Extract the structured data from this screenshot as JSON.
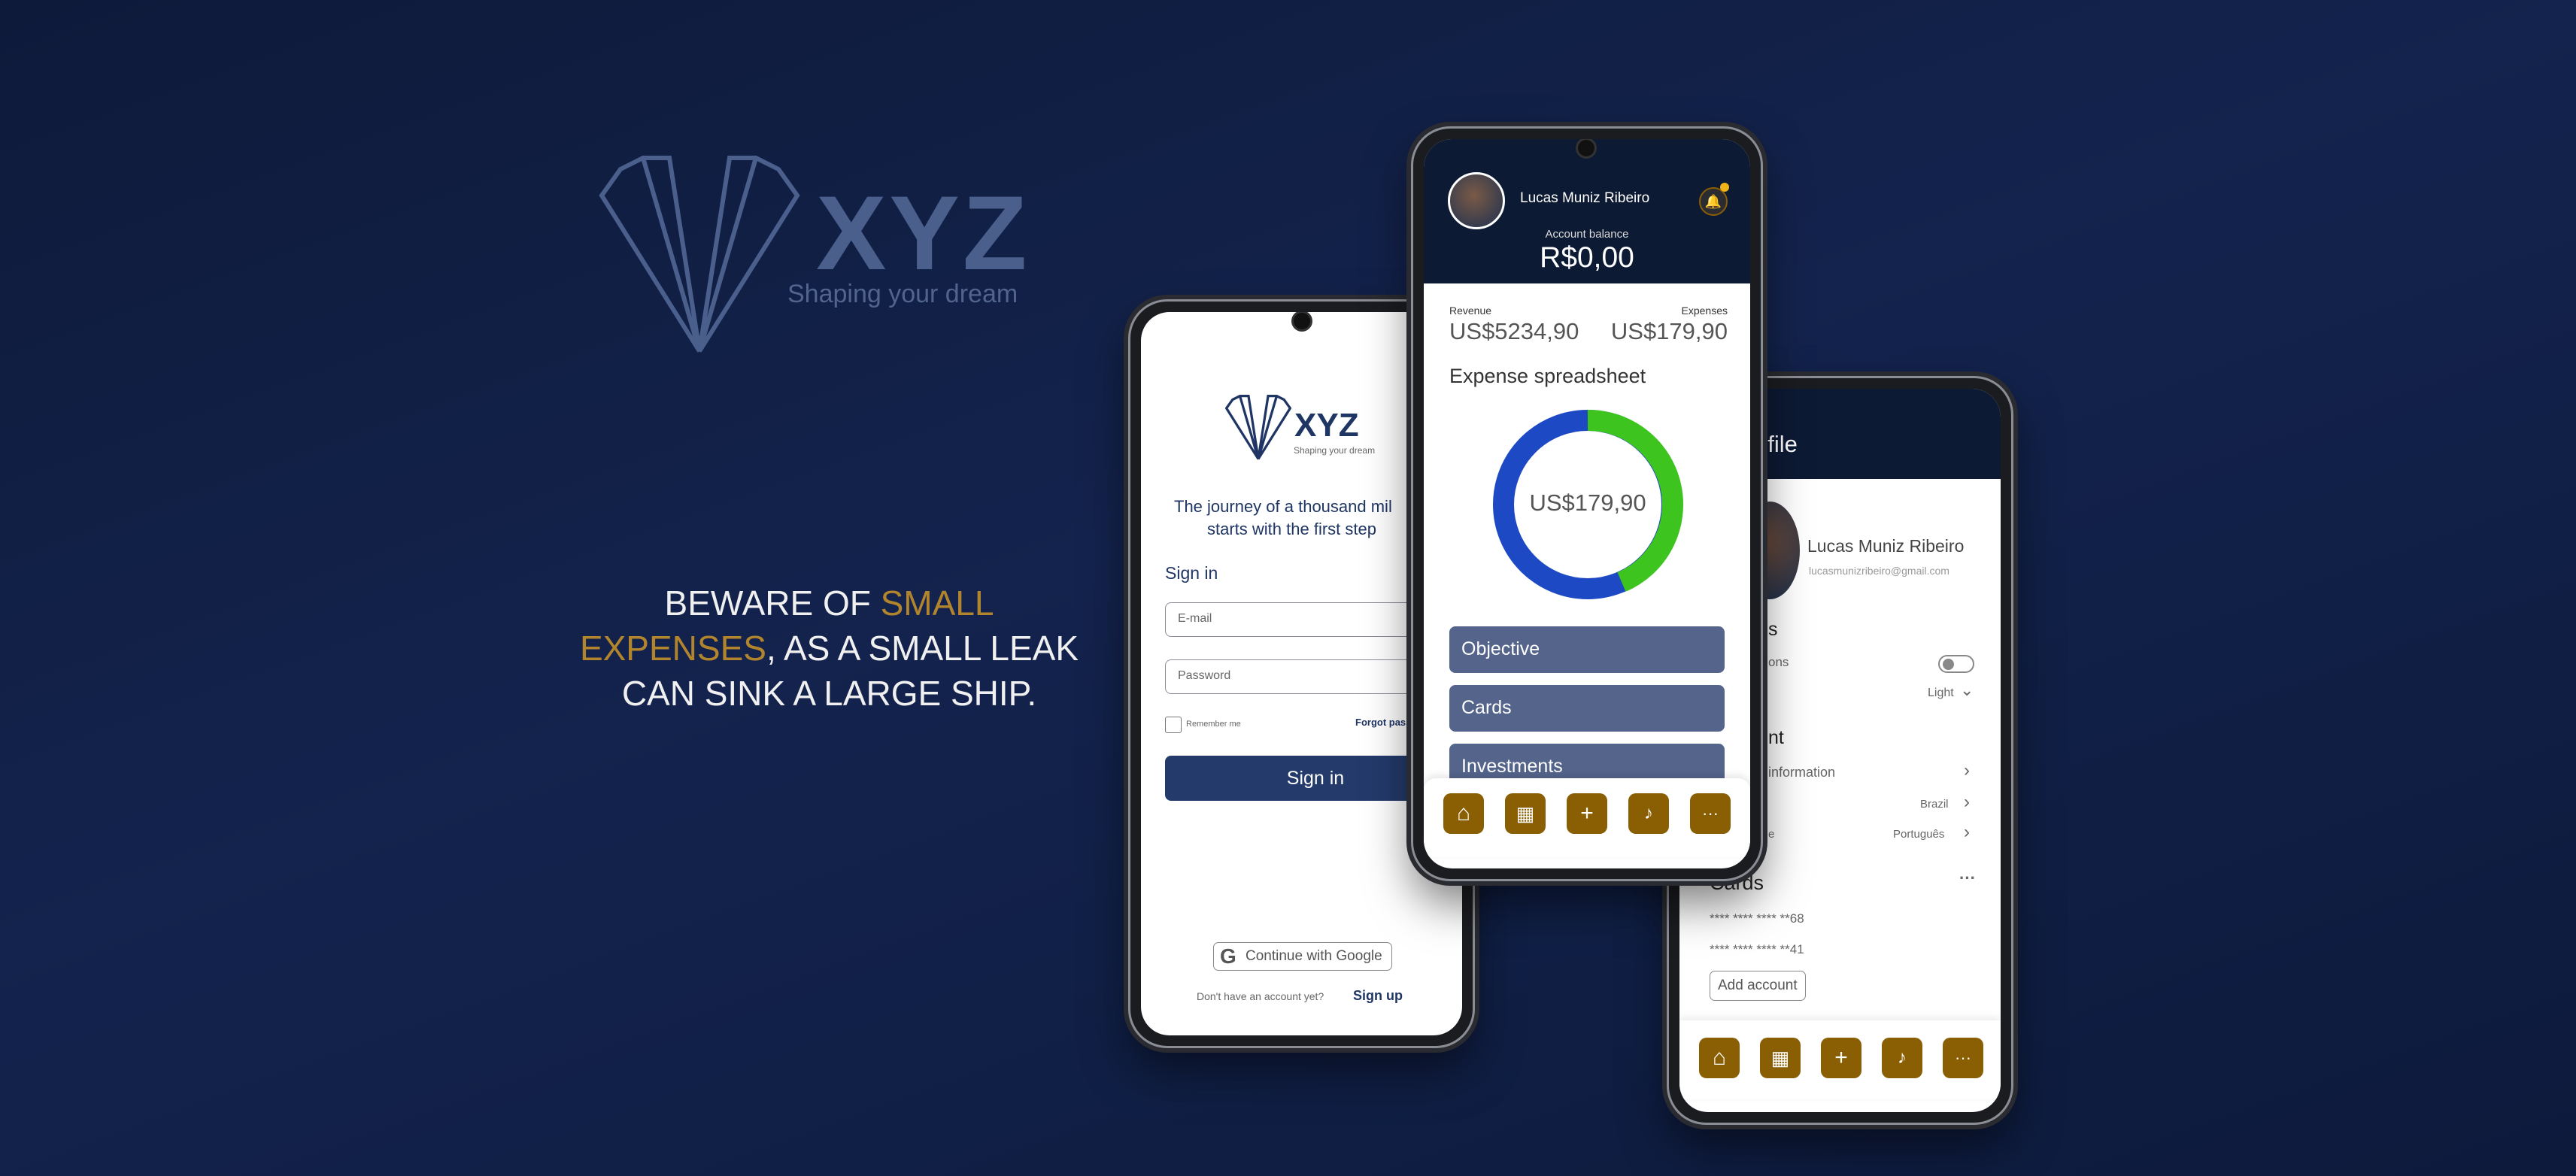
{
  "brand": {
    "name": "XYZ",
    "tagline": "Shaping your dream"
  },
  "quote": {
    "part1": "BEWARE OF ",
    "highlight1": "SMALL",
    "highlight2": "EXPENSES",
    "part2": ", AS A SMALL LEAK",
    "part3": "CAN SINK A LARGE SHIP."
  },
  "login": {
    "logo_name": "XYZ",
    "logo_tagline": "Shaping your dream",
    "headline_line1": "The journey of a thousand mil",
    "headline_line2": "starts with the first step",
    "signin_title": "Sign in",
    "email_placeholder": "E-mail",
    "password_placeholder": "Password",
    "remember_label": "Remember me",
    "forgot_label": "Forgot pass",
    "signin_button": "Sign in",
    "google_button": "Continue with Google",
    "no_account": "Don't have an account yet?",
    "signup_link": "Sign up"
  },
  "main": {
    "user_name": "Lucas Muniz Ribeiro",
    "balance_label": "Account balance",
    "balance_value": "R$0,00",
    "revenue_label": "Revenue",
    "revenue_value": "US$5234,90",
    "expenses_label": "Expenses",
    "expenses_value": "US$179,90",
    "spreadsheet_title": "Expense spreadsheet",
    "donut_value": "US$179,90",
    "sections": [
      "Objective",
      "Cards",
      "Investments"
    ],
    "colors": {
      "blue": "#1d49c4",
      "green": "#3dc41f",
      "header": "#0d1a34",
      "gold": "#8a5f04"
    }
  },
  "nav_icons": [
    "home-icon",
    "table-icon",
    "plus-icon",
    "bell-icon",
    "more-icon"
  ],
  "nav_symbols": [
    "⌂",
    "▦",
    "+",
    "🔔",
    "···"
  ],
  "profile": {
    "title": "ofile",
    "user_name": "Lucas Muniz Ribeiro",
    "email": "lucasmunizribeiro@gmail.com",
    "section1": "s",
    "notifications": "ons",
    "theme_value": "Light",
    "section2": "nt",
    "info_label": "information",
    "country_value": "Brazil",
    "language_label": "e",
    "language_value": "Português",
    "cards_title": "Cards",
    "card1": "**** **** **** **68",
    "card2": "**** **** **** **41",
    "add_account": "Add account"
  }
}
